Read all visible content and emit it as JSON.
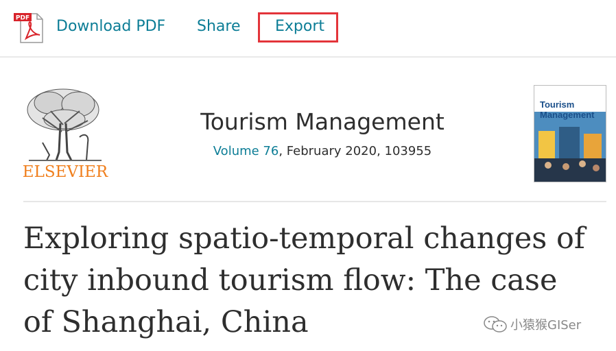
{
  "toolbar": {
    "pdf_badge": "PDF",
    "download_label": "Download PDF",
    "share_label": "Share",
    "export_label": "Export"
  },
  "journal": {
    "publisher_logo_text": "ELSEVIER",
    "title": "Tourism Management",
    "volume_label": "Volume 76",
    "issue_info": ", February 2020, 103955",
    "cover_title": "Tourism Management"
  },
  "article": {
    "title": "Exploring spatio-temporal changes of city inbound tourism flow: The case of Shanghai, China"
  },
  "watermark": {
    "text": "小猿猴GISer"
  },
  "colors": {
    "link": "#0c7d96",
    "highlight_box": "#e3343a",
    "elsevier_orange": "#f07f1d",
    "text": "#2e2e2e"
  }
}
